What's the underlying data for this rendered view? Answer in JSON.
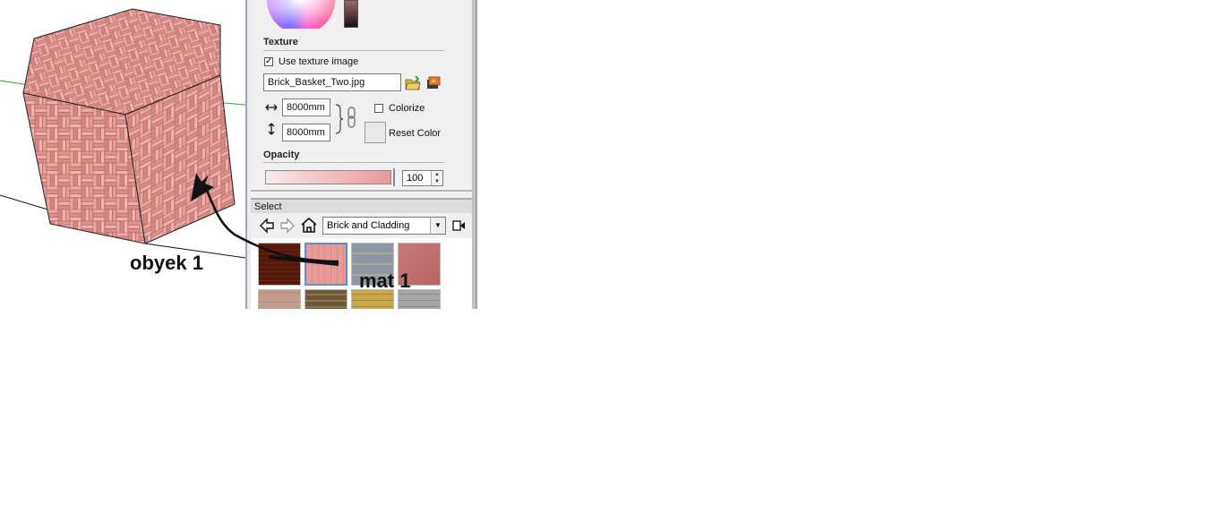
{
  "viewport": {
    "object_label": "obyek 1"
  },
  "panel": {
    "texture": {
      "section_title": "Texture",
      "use_texture_label": "Use texture image",
      "use_texture_checked": true,
      "filename": "Brick_Basket_Two.jpg",
      "width_value": "8000mm",
      "height_value": "8000mm",
      "colorize_label": "Colorize",
      "colorize_checked": false,
      "reset_color_label": "Reset Color"
    },
    "opacity": {
      "section_title": "Opacity",
      "value": "100",
      "level": 1.0
    },
    "select": {
      "title": "Select",
      "collection": "Brick and Cladding"
    },
    "annotation_label": "mat 1"
  },
  "icons": {
    "back": "back-arrow-icon",
    "forward": "forward-arrow-icon",
    "home": "home-icon",
    "details": "details-arrow-icon",
    "browse": "open-folder-icon",
    "edit": "edit-texture-icon",
    "lock_aspect": "chain-link-icon",
    "width_arrow": "horizontal-resize-icon",
    "height_arrow": "vertical-resize-icon"
  },
  "colors": {
    "brick_pink": "#e79a97",
    "panel_bg": "#f0f0f0",
    "selection": "#5a8fd0"
  }
}
